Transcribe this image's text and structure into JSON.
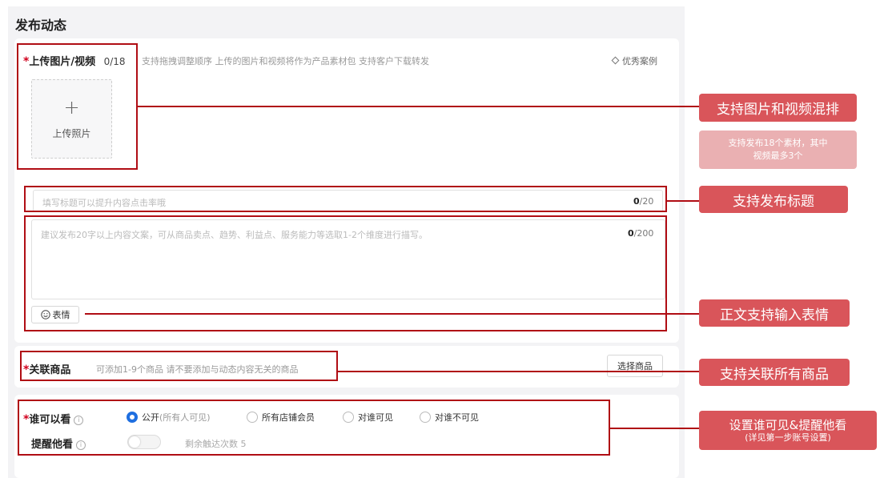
{
  "page": {
    "title": "发布动态"
  },
  "media": {
    "label": "上传图片/视频",
    "count": "0/18",
    "hint": "支持拖拽调整顺序 上传的图片和视频将作为产品素材包 支持客户下载转发",
    "examples_link": "优秀案例",
    "upload_icon": "plus-icon",
    "upload_label": "上传照片"
  },
  "title_input": {
    "placeholder": "填写标题可以提升内容点击率哦",
    "count_current": "0",
    "count_max": "/20"
  },
  "content_input": {
    "placeholder": "建议发布20字以上内容文案，可从商品卖点、趋势、利益点、服务能力等选取1-2个维度进行描写。",
    "count_current": "0",
    "count_max": "/200",
    "emoji_icon": "smiley-icon",
    "emoji_label": "表情"
  },
  "products": {
    "label": "关联商品",
    "hint": "可添加1-9个商品  请不要添加与动态内容无关的商品",
    "select_button": "选择商品"
  },
  "visibility": {
    "label": "谁可以看",
    "options": [
      {
        "label": "公开",
        "sub": "(所有人可见)",
        "selected": true
      },
      {
        "label": "所有店铺会员",
        "selected": false
      },
      {
        "label": "对谁可见",
        "selected": false
      },
      {
        "label": "对谁不可见",
        "selected": false
      }
    ]
  },
  "remind": {
    "label": "提醒他看",
    "remaining": "剩余触达次数 5",
    "enabled": false
  },
  "annotations": {
    "mixed_media": "支持图片和视频混排",
    "media_limit_line1": "支持发布18个素材，其中",
    "media_limit_line2": "视频最多3个",
    "title_support": "支持发布标题",
    "emoji_support": "正文支持输入表情",
    "products_support": "支持关联所有商品",
    "visibility_line1": "设置谁可见&提醒他看",
    "visibility_line2": "(详见第一步账号设置)"
  },
  "colors": {
    "accent": "#1f6fe0",
    "required": "#d1001d",
    "annotation_box": "#b00d14",
    "callout": "#d9555a",
    "callout_light": "#eab0b2"
  }
}
